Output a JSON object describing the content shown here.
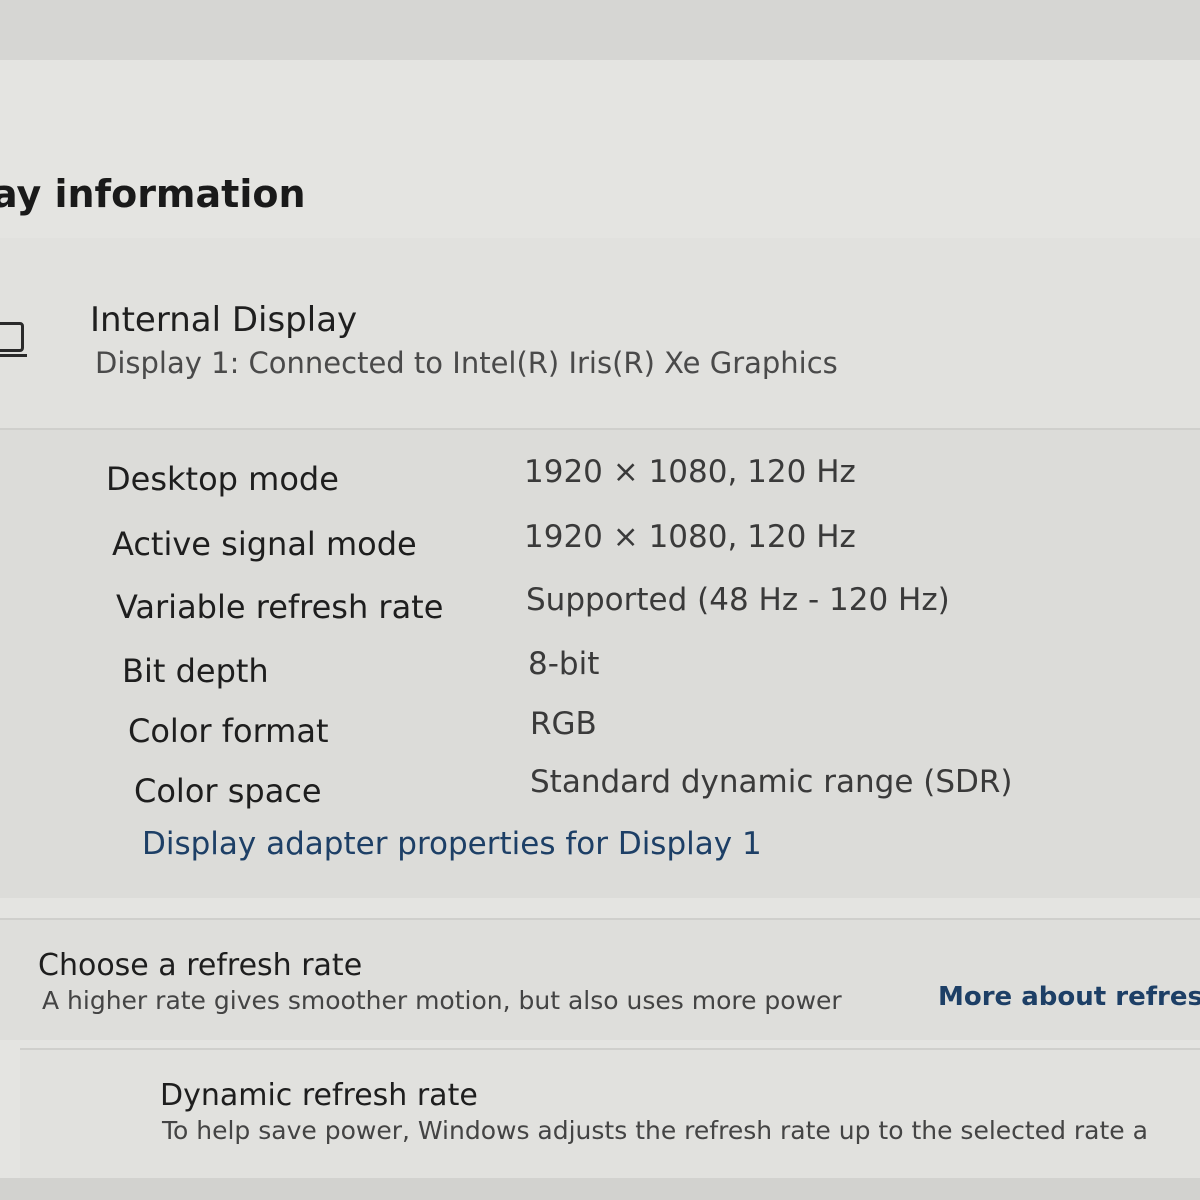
{
  "section": {
    "title": "ay information"
  },
  "display": {
    "name": "Internal Display",
    "subtitle": "Display 1: Connected to Intel(R) Iris(R) Xe Graphics",
    "icon": "monitor-icon"
  },
  "info_rows": [
    {
      "label": "Desktop mode",
      "value": "1920 × 1080, 120 Hz"
    },
    {
      "label": "Active signal mode",
      "value": "1920 × 1080, 120 Hz"
    },
    {
      "label": "Variable refresh rate",
      "value": "Supported (48 Hz - 120 Hz)"
    },
    {
      "label": "Bit depth",
      "value": "8-bit"
    },
    {
      "label": "Color format",
      "value": "RGB"
    },
    {
      "label": "Color space",
      "value": "Standard dynamic range (SDR)"
    }
  ],
  "adapter_link": "Display adapter properties for Display 1",
  "refresh": {
    "title": "Choose a refresh rate",
    "description": "A higher rate gives smoother motion, but also uses more power",
    "link": "More about refresh"
  },
  "dynamic": {
    "title": "Dynamic refresh rate",
    "description": "To help save power, Windows adjusts the refresh rate up to the selected rate a"
  },
  "colors": {
    "link": "#1d3f66",
    "background": "#e4e4e1"
  }
}
